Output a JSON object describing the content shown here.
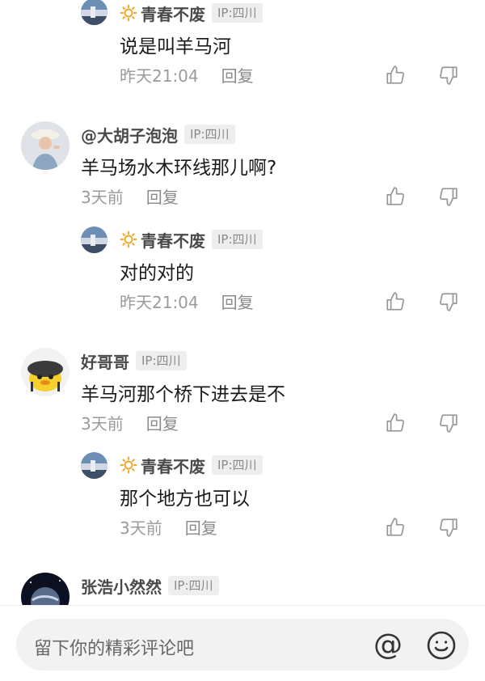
{
  "comments": [
    {
      "type": "reply",
      "user": "青春不废",
      "ip": "IP:四川",
      "text": "说是叫羊马河",
      "time": "昨天21:04",
      "reply_label": "回复",
      "avatar": "landscape-avatar",
      "has_badge": true
    },
    {
      "type": "top",
      "user": "@大胡子泡泡",
      "ip": "IP:四川",
      "text": "羊马场水木环线那儿啊?",
      "time": "3天前",
      "reply_label": "回复",
      "avatar": "woman-hat-avatar"
    },
    {
      "type": "reply",
      "user": "青春不废",
      "ip": "IP:四川",
      "text": "对的对的",
      "time": "昨天21:04",
      "reply_label": "回复",
      "avatar": "landscape-avatar",
      "has_badge": true
    },
    {
      "type": "top",
      "user": "好哥哥",
      "ip": "IP:四川",
      "text": "羊马河那个桥下进去是不",
      "time": "3天前",
      "reply_label": "回复",
      "avatar": "cartoon-duck-avatar"
    },
    {
      "type": "reply",
      "user": "青春不废",
      "ip": "IP:四川",
      "text": "那个地方也可以",
      "time": "3天前",
      "reply_label": "回复",
      "avatar": "landscape-avatar",
      "has_badge": true
    },
    {
      "type": "top",
      "user": "张浩小然然",
      "ip": "IP:四川",
      "text": "",
      "time": "",
      "reply_label": "",
      "avatar": "planet-avatar"
    }
  ],
  "input": {
    "placeholder": "留下你的精彩评论吧"
  },
  "icons": {
    "at": "at-icon",
    "emoji": "emoji-icon",
    "like": "thumbs-up-icon",
    "dislike": "thumbs-down-icon",
    "badge": "sun-badge-icon"
  },
  "colors": {
    "username": "#4a4a4a",
    "badge": "#f0a830",
    "meta": "#9a9a9a",
    "ip_bg": "#eeeeee"
  }
}
